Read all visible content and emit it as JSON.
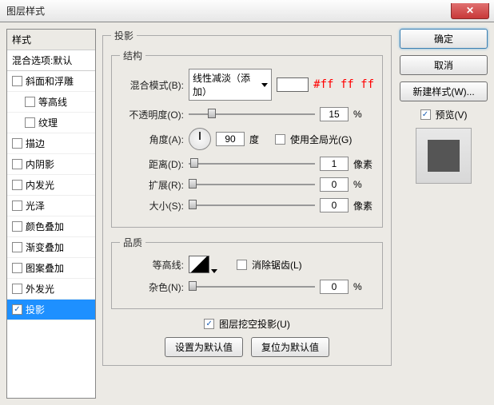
{
  "window": {
    "title": "图层样式",
    "close_icon": "✕"
  },
  "left": {
    "header": "样式",
    "blend_options": "混合选项:默认",
    "items": [
      {
        "label": "斜面和浮雕",
        "checked": false,
        "indent": false
      },
      {
        "label": "等高线",
        "checked": false,
        "indent": true
      },
      {
        "label": "纹理",
        "checked": false,
        "indent": true
      },
      {
        "label": "描边",
        "checked": false,
        "indent": false
      },
      {
        "label": "内阴影",
        "checked": false,
        "indent": false
      },
      {
        "label": "内发光",
        "checked": false,
        "indent": false
      },
      {
        "label": "光泽",
        "checked": false,
        "indent": false
      },
      {
        "label": "颜色叠加",
        "checked": false,
        "indent": false
      },
      {
        "label": "渐变叠加",
        "checked": false,
        "indent": false
      },
      {
        "label": "图案叠加",
        "checked": false,
        "indent": false
      },
      {
        "label": "外发光",
        "checked": false,
        "indent": false
      },
      {
        "label": "投影",
        "checked": true,
        "indent": false,
        "selected": true
      }
    ]
  },
  "center": {
    "main_legend": "投影",
    "structure_legend": "结构",
    "blend_mode_label": "混合模式(B):",
    "blend_mode_value": "线性减淡（添加）",
    "hex_value": "#ff ff ff",
    "opacity_label": "不透明度(O):",
    "opacity_value": "15",
    "opacity_unit": "%",
    "angle_label": "角度(A):",
    "angle_value": "90",
    "angle_unit": "度",
    "global_light_label": "使用全局光(G)",
    "global_light_checked": false,
    "distance_label": "距离(D):",
    "distance_value": "1",
    "distance_unit": "像素",
    "spread_label": "扩展(R):",
    "spread_value": "0",
    "spread_unit": "%",
    "size_label": "大小(S):",
    "size_value": "0",
    "size_unit": "像素",
    "quality_legend": "品质",
    "contour_label": "等高线:",
    "antialias_label": "消除锯齿(L)",
    "antialias_checked": false,
    "noise_label": "杂色(N):",
    "noise_value": "0",
    "noise_unit": "%",
    "knockout_label": "图层挖空投影(U)",
    "knockout_checked": true,
    "reset_default": "设置为默认值",
    "revert_default": "复位为默认值"
  },
  "right": {
    "ok": "确定",
    "cancel": "取消",
    "new_style": "新建样式(W)...",
    "preview_label": "预览(V)",
    "preview_checked": true
  }
}
